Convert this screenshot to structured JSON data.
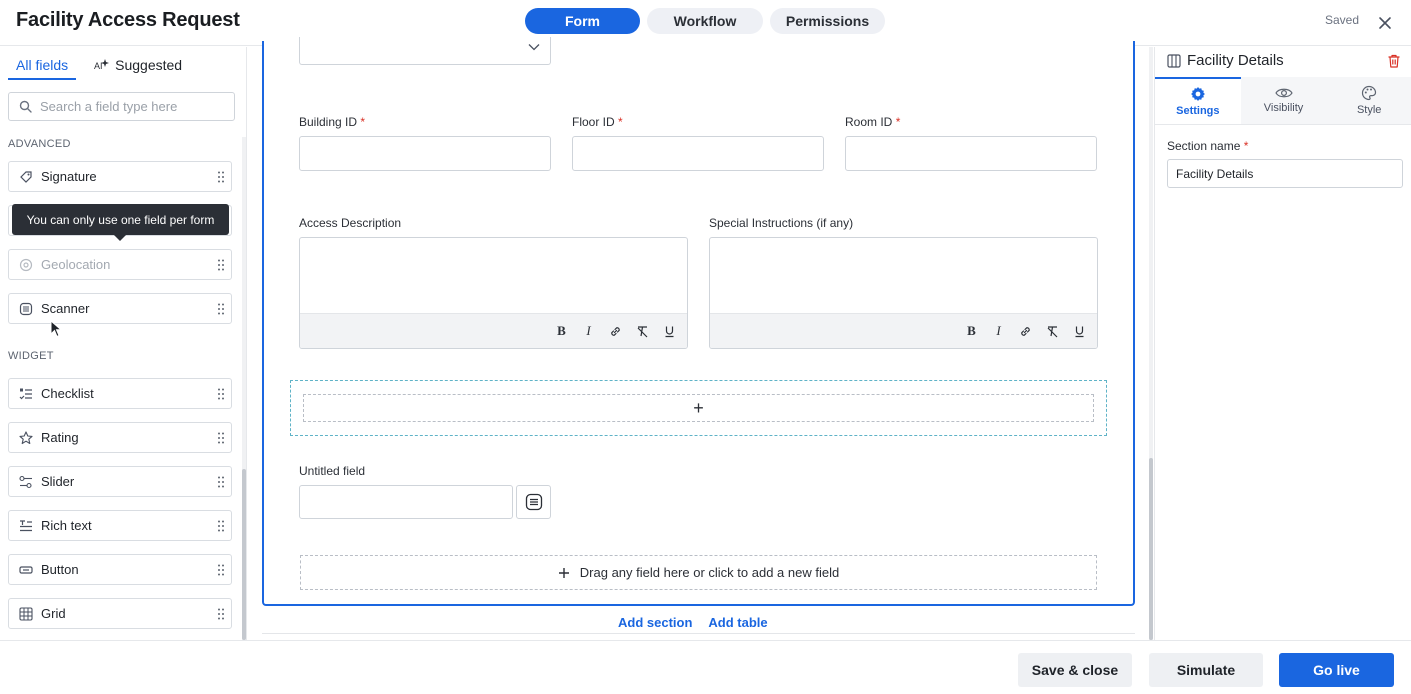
{
  "header": {
    "title": "Facility Access Request",
    "tabs": [
      {
        "label": "Form",
        "active": true
      },
      {
        "label": "Workflow",
        "active": false
      },
      {
        "label": "Permissions",
        "active": false
      }
    ],
    "status": "Saved"
  },
  "left_panel": {
    "tabs": [
      {
        "label": "All fields",
        "active": true
      },
      {
        "label": "Suggested",
        "active": false
      }
    ],
    "search_placeholder": "Search a field type here",
    "groups": [
      {
        "label": "ADVANCED",
        "items": [
          {
            "label": "Signature",
            "icon": "signature-icon",
            "disabled": false
          },
          {
            "label": "Geolocation",
            "icon": "geolocation-icon",
            "disabled": true
          },
          {
            "label": "Scanner",
            "icon": "scanner-icon",
            "disabled": false
          }
        ]
      },
      {
        "label": "WIDGET",
        "items": [
          {
            "label": "Checklist",
            "icon": "checklist-icon"
          },
          {
            "label": "Rating",
            "icon": "star-icon"
          },
          {
            "label": "Slider",
            "icon": "slider-icon"
          },
          {
            "label": "Rich text",
            "icon": "rich-text-icon"
          },
          {
            "label": "Button",
            "icon": "button-icon"
          },
          {
            "label": "Grid",
            "icon": "grid-icon"
          }
        ]
      }
    ],
    "tooltip": "You can only use one field per form"
  },
  "canvas": {
    "fields": {
      "building_id": {
        "label": "Building ID",
        "required": "*"
      },
      "floor_id": {
        "label": "Floor ID",
        "required": "*"
      },
      "room_id": {
        "label": "Room ID",
        "required": "*"
      },
      "access_description": {
        "label": "Access Description"
      },
      "special_instructions": {
        "label": "Special Instructions (if any)"
      },
      "untitled": {
        "label": "Untitled field"
      }
    },
    "rte_toolbar": [
      "B",
      "I",
      "link",
      "clear-format",
      "U"
    ],
    "drop_zone_symbol": "+",
    "drag_add_text": "Drag any field here or click to add a new field",
    "add_section": "Add section",
    "add_table": "Add table"
  },
  "right_panel": {
    "title": "Facility Details",
    "tabs": [
      {
        "label": "Settings",
        "icon": "gear-icon",
        "active": true
      },
      {
        "label": "Visibility",
        "icon": "eye-icon",
        "active": false
      },
      {
        "label": "Style",
        "icon": "palette-icon",
        "active": false
      }
    ],
    "section_name_label": "Section name",
    "section_name_required": "*",
    "section_name_value": "Facility Details"
  },
  "footer": {
    "save_close": "Save & close",
    "simulate": "Simulate",
    "go_live": "Go live"
  },
  "colors": {
    "accent": "#1a66e0",
    "required": "#d93025",
    "drop_zone_border": "#5fb3c7"
  }
}
